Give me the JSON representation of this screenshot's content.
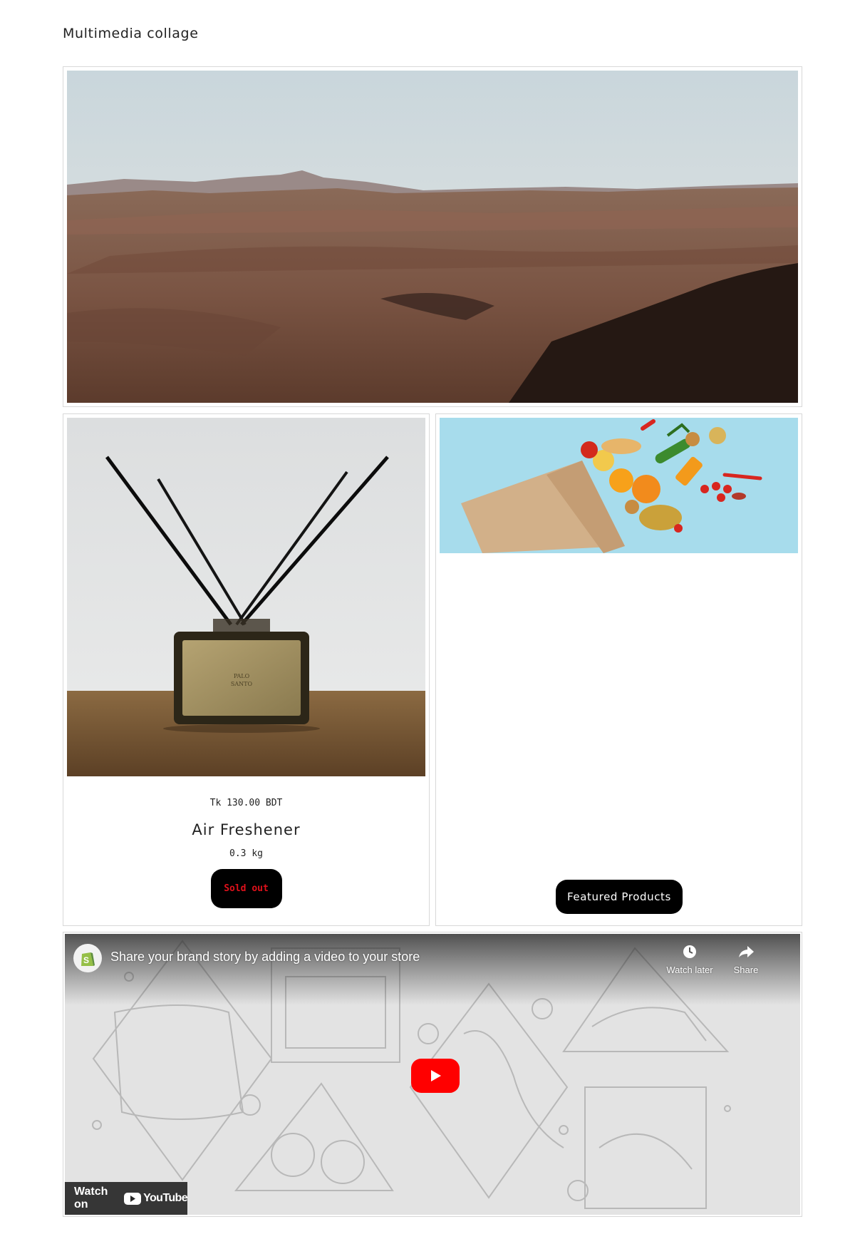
{
  "section": {
    "title": "Multimedia collage"
  },
  "hero": {
    "image_icon": "desert-landscape-image"
  },
  "product": {
    "image_icon": "reed-diffuser-image",
    "price": "Tk 130.00 BDT",
    "name": "Air Freshener",
    "weight": "0.3 kg",
    "button_label": "Sold out"
  },
  "collection": {
    "image_icon": "grocery-bag-image",
    "button_label": "Featured Products"
  },
  "video": {
    "title": "Share your brand story by adding a video to your store",
    "watch_later": "Watch later",
    "share": "Share",
    "watch_on": "Watch on",
    "youtube": "YouTube"
  },
  "colors": {
    "soldout_text": "#e0111b",
    "button_bg": "#000000",
    "youtube_red": "#ff0000"
  }
}
